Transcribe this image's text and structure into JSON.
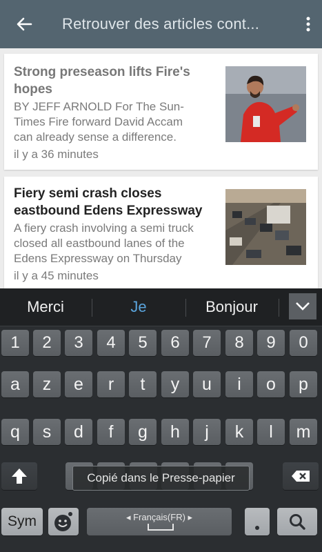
{
  "appbar": {
    "title": "Retrouver des articles cont..."
  },
  "articles": [
    {
      "headline_line1": "Strong preseason lifts Fire's",
      "headline_line2": "hopes",
      "snippet_line1": "BY JEFF ARNOLD For The Sun-",
      "snippet_line2": "Times Fire forward David Accam",
      "snippet_line3": "can already sense a difference.",
      "time": "il y a 36 minutes",
      "headline_color": "#777777"
    },
    {
      "headline_line1": "Fiery semi crash closes",
      "headline_line2": "eastbound Edens Expressway",
      "snippet_line1": "A fiery crash involving a semi truck",
      "snippet_line2": "closed all eastbound lanes of the",
      "snippet_line3": "Edens Expressway on Thursday",
      "time": "il y a 45 minutes",
      "headline_color": "#222222"
    }
  ],
  "keyboard": {
    "suggestions": [
      "Merci",
      "Je",
      "Bonjour"
    ],
    "number_row": [
      "1",
      "2",
      "3",
      "4",
      "5",
      "6",
      "7",
      "8",
      "9",
      "0"
    ],
    "row1": [
      "a",
      "z",
      "e",
      "r",
      "t",
      "y",
      "u",
      "i",
      "o",
      "p"
    ],
    "row2": [
      "q",
      "s",
      "d",
      "f",
      "g",
      "h",
      "j",
      "k",
      "l",
      "m"
    ],
    "sym_label": "Sym",
    "language_label": "Français(FR)",
    "toast": "Copié dans le Presse-papier"
  }
}
